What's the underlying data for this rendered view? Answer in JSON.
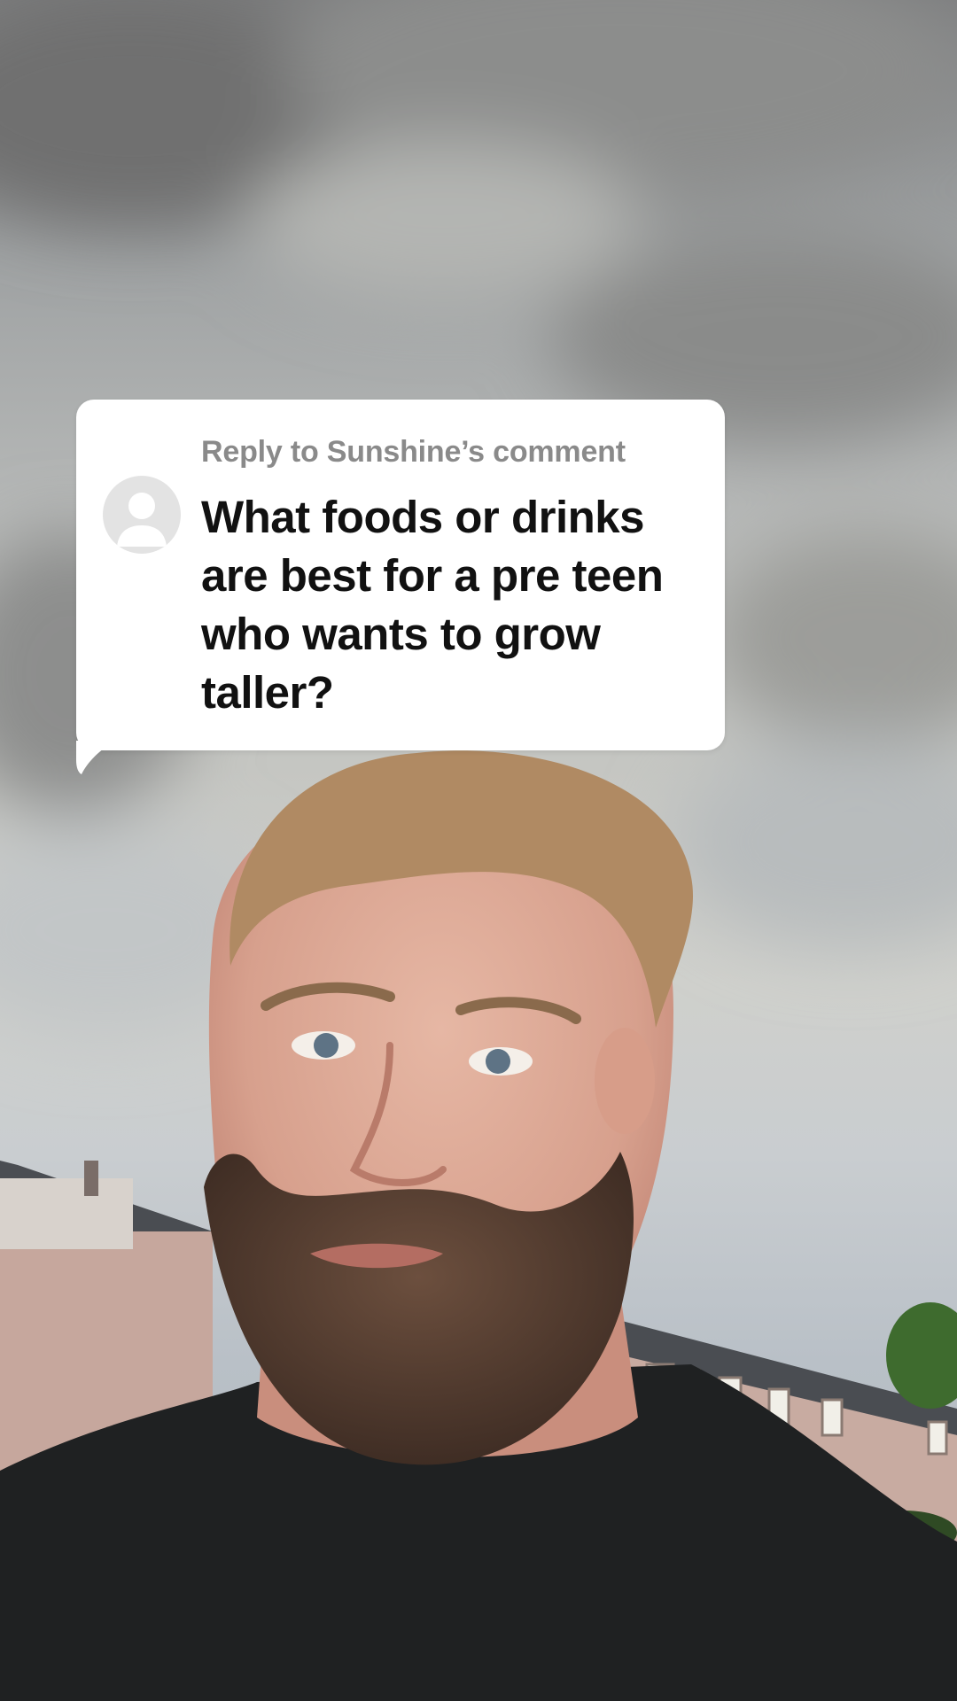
{
  "reply_card": {
    "header": "Reply to Sunshine’s comment",
    "comment_text": "What foods or drinks are best for a pre teen who wants to grow taller?",
    "avatar_icon": "default-user-avatar-icon"
  },
  "colors": {
    "card_background": "#ffffff",
    "header_text": "#8a8a8a",
    "comment_text": "#111111",
    "avatar_bg": "#e3e3e3",
    "avatar_figure": "#ffffff"
  }
}
